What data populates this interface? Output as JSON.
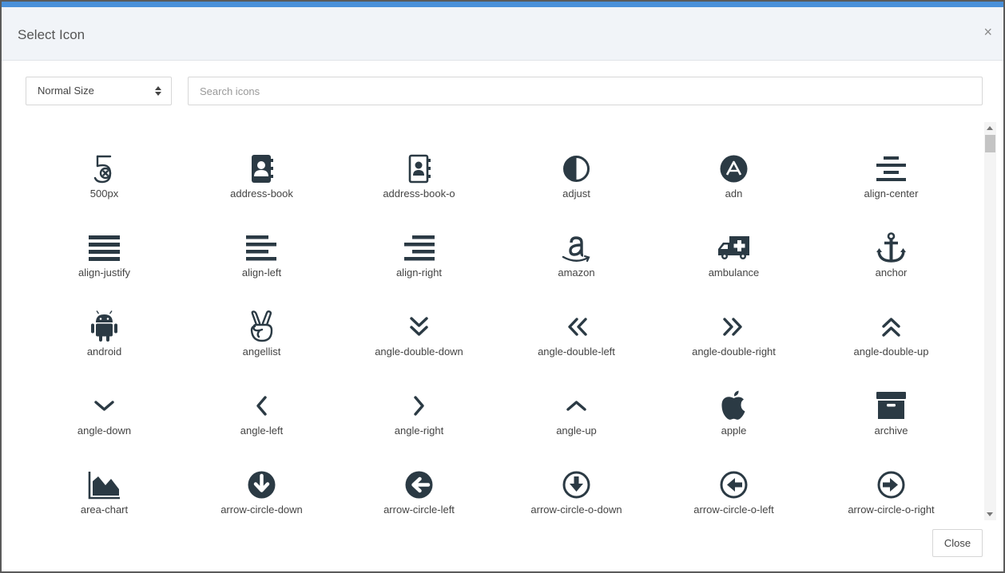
{
  "dialog": {
    "title": "Select Icon",
    "close_x": "×",
    "size_select": {
      "value": "Normal Size"
    },
    "search": {
      "placeholder": "Search icons",
      "value": ""
    },
    "close_button": "Close",
    "accent_color": "#4a90d9",
    "icon_color": "#2b3a44"
  },
  "icons": [
    "500px",
    "address-book",
    "address-book-o",
    "adjust",
    "adn",
    "align-center",
    "align-justify",
    "align-left",
    "align-right",
    "amazon",
    "ambulance",
    "anchor",
    "android",
    "angellist",
    "angle-double-down",
    "angle-double-left",
    "angle-double-right",
    "angle-double-up",
    "angle-down",
    "angle-left",
    "angle-right",
    "angle-up",
    "apple",
    "archive",
    "area-chart",
    "arrow-circle-down",
    "arrow-circle-left",
    "arrow-circle-o-down",
    "arrow-circle-o-left",
    "arrow-circle-o-right"
  ]
}
